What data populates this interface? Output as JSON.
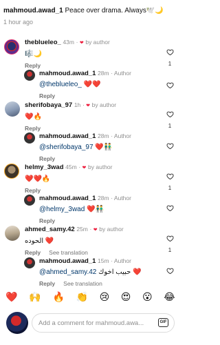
{
  "post": {
    "caption_user": "mahmoud.awad_1",
    "caption_text": "Peace over drama. Always🕊️🌙",
    "caption_time": "1 hour ago"
  },
  "comments": [
    {
      "user": "theblueleo_",
      "time": "43m",
      "badge": "by author",
      "text": "🎼🌙",
      "reply_label": "Reply",
      "likes": "1"
    },
    {
      "user": "mahmoud.awad_1",
      "time": "28m",
      "badge": "Author",
      "mention": "@theblueleo_",
      "text": "❤️❤️",
      "reply_label": "Reply"
    },
    {
      "user": "sherifobaya_97",
      "time": "1h",
      "badge": "by author",
      "text": "❤️🔥",
      "reply_label": "Reply",
      "likes": "1"
    },
    {
      "user": "mahmoud.awad_1",
      "time": "28m",
      "badge": "Author",
      "mention": "@sherifobaya_97",
      "text": "❤️👬",
      "reply_label": "Reply"
    },
    {
      "user": "helmy_3wad",
      "time": "45m",
      "badge": "by author",
      "text": "❤️❤️🔥",
      "reply_label": "Reply",
      "likes": "1"
    },
    {
      "user": "mahmoud.awad_1",
      "time": "28m",
      "badge": "Author",
      "mention": "@helmy_3wad",
      "text": "❤️👬",
      "reply_label": "Reply"
    },
    {
      "user": "ahmed_samy.42",
      "time": "25m",
      "badge": "by author",
      "text": "الحوده ❤️",
      "reply_label": "Reply",
      "translate_label": "See translation",
      "likes": "1"
    },
    {
      "user": "mahmoud.awad_1",
      "time": "15m",
      "badge": "Author",
      "mention": "@ahmed_samy.42",
      "text": "حبيب اخوك ❤️",
      "reply_label": "Reply",
      "translate_label": "See translation"
    }
  ],
  "reactions": [
    "❤️",
    "🙌",
    "🔥",
    "👏",
    "😢",
    "😍",
    "😮",
    "😂"
  ],
  "composer": {
    "placeholder": "Add a comment for mahmoud.awa...",
    "gif_label": "GIF"
  }
}
